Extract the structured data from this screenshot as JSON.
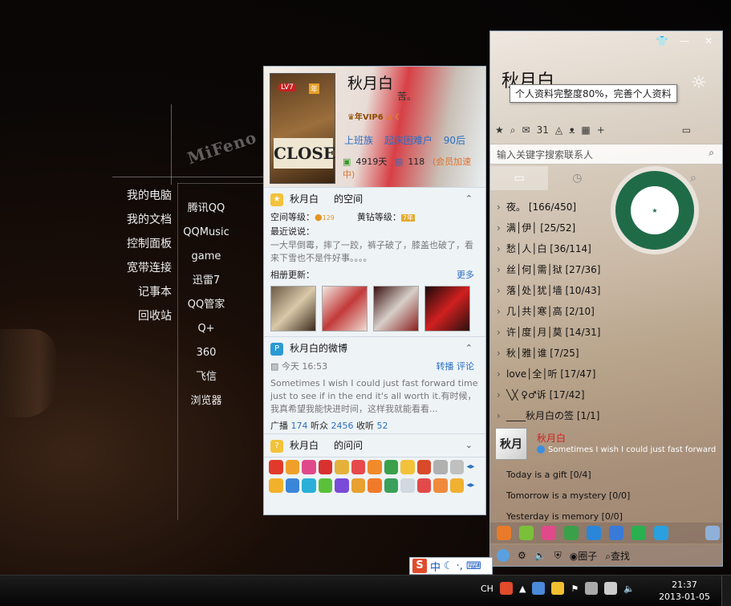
{
  "desktop": {
    "logo": "MiFeno",
    "left_menu": [
      "我的电脑",
      "我的文档",
      "控制面板",
      "宽带连接",
      "记事本",
      "回收站"
    ],
    "right_menu": [
      "腾讯QQ",
      "QQMusic",
      "game",
      "迅雷7",
      "QQ管家",
      "Q+",
      "360",
      "飞信",
      "浏览器"
    ]
  },
  "profile_card": {
    "level_badge": "LV7",
    "year_badge": "年",
    "avatar_text": "CLOSE",
    "name": "秋月白",
    "signature": "苦。",
    "vip_label": "年VIP6",
    "tags": [
      "上班族",
      "起床困难户",
      "90后"
    ],
    "days": "4919天",
    "speed": "118",
    "speed_note": "(会员加速中)",
    "space_section": {
      "owner": "秋月白",
      "title": "的空间",
      "level_label": "空间等级：",
      "level_value": "129",
      "yellow_label": "黄钻等级：",
      "yellow_value": "7年"
    },
    "recent_label": "最近说说：",
    "recent_text": "一大早倒霉，摔了一跤，裤子破了，膝盖也破了，看来下雪也不是件好事。。。。",
    "album_label": "相册更新：",
    "album_more": "更多",
    "weibo_section": {
      "title": "秋月白的微博",
      "time": "今天 16:53",
      "repost": "转播",
      "comment": "评论",
      "text": "Sometimes I wish I could just fast forward time just to see if in the end it's all worth it.有时候，我真希望我能快进时间，这样我就能看看...",
      "broadcast_label": "广播",
      "broadcast": "174",
      "listeners_label": "听众",
      "listeners": "2456",
      "listening_label": "收听",
      "listening": "52"
    },
    "ask_section": {
      "owner": "秋月白",
      "title": "的问问"
    }
  },
  "qq_panel": {
    "name": "秋月白",
    "tooltip": "个人资料完整度80%，完善个人资料",
    "mail_count": "31",
    "search_placeholder": "输入关键字搜索联系人",
    "groups": [
      {
        "label": "夜。 [166/450]"
      },
      {
        "label": "满│伊│ [25/52]"
      },
      {
        "label": "愁│人│白 [36/114]"
      },
      {
        "label": "丝│何│需│狱 [27/36]"
      },
      {
        "label": "落│处│犹│墙 [10/43]"
      },
      {
        "label": "几│共│寒│高 [2/10]"
      },
      {
        "label": "许│度│月│莫 [14/31]"
      },
      {
        "label": "秋│雅│谁 [7/25]"
      },
      {
        "label": "love│全│听 [17/47]"
      },
      {
        "label": "╲╳ ♀♂诉 [17/42]"
      },
      {
        "label": "____秋月白の签 [1/1]"
      }
    ],
    "friend": {
      "avatar_text": "秋月",
      "name": "秋月白",
      "status": "Sometimes I wish I could just fast forward"
    },
    "moods": [
      "Today is a gift   [0/4]",
      "Tomorrow is a mystery   [0/0]",
      "Yesterday is memory   [0/0]"
    ],
    "bottom_labels": {
      "circle": "圈子",
      "find": "查找"
    }
  },
  "ime": {
    "mode": "中"
  },
  "taskbar": {
    "lang": "CH",
    "time": "21:37",
    "date": "2013-01-05"
  }
}
